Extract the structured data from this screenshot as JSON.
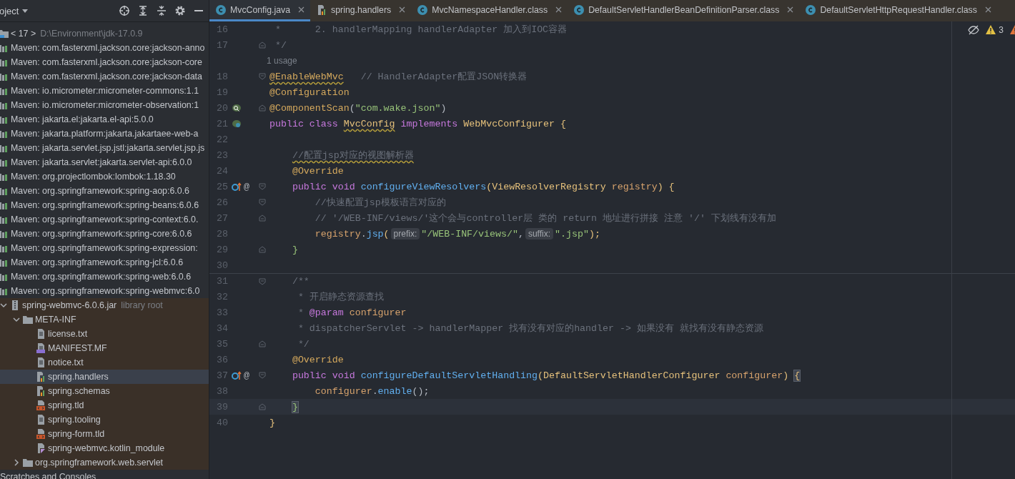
{
  "project_panel": {
    "title": "oject",
    "tree": [
      {
        "kind": "jdk",
        "label": "< 17 >",
        "detail": "D:\\Environment\\jdk-17.0.9",
        "selected": false
      },
      {
        "kind": "maven",
        "label": "Maven: com.fasterxml.jackson.core:jackson-anno",
        "selected": false
      },
      {
        "kind": "maven",
        "label": "Maven: com.fasterxml.jackson.core:jackson-core",
        "selected": false
      },
      {
        "kind": "maven",
        "label": "Maven: com.fasterxml.jackson.core:jackson-data",
        "selected": false
      },
      {
        "kind": "maven",
        "label": "Maven: io.micrometer:micrometer-commons:1.1",
        "selected": false
      },
      {
        "kind": "maven",
        "label": "Maven: io.micrometer:micrometer-observation:1",
        "selected": false
      },
      {
        "kind": "maven",
        "label": "Maven: jakarta.el:jakarta.el-api:5.0.0",
        "selected": false
      },
      {
        "kind": "maven",
        "label": "Maven: jakarta.platform:jakarta.jakartaee-web-a",
        "selected": false
      },
      {
        "kind": "maven",
        "label": "Maven: jakarta.servlet.jsp.jstl:jakarta.servlet.jsp.js",
        "selected": false
      },
      {
        "kind": "maven",
        "label": "Maven: jakarta.servlet:jakarta.servlet-api:6.0.0",
        "selected": false
      },
      {
        "kind": "maven",
        "label": "Maven: org.projectlombok:lombok:1.18.30",
        "selected": false
      },
      {
        "kind": "maven",
        "label": "Maven: org.springframework:spring-aop:6.0.6",
        "selected": false
      },
      {
        "kind": "maven",
        "label": "Maven: org.springframework:spring-beans:6.0.6",
        "selected": false
      },
      {
        "kind": "maven",
        "label": "Maven: org.springframework:spring-context:6.0.",
        "selected": false
      },
      {
        "kind": "maven",
        "label": "Maven: org.springframework:spring-core:6.0.6",
        "selected": false
      },
      {
        "kind": "maven",
        "label": "Maven: org.springframework:spring-expression:",
        "selected": false
      },
      {
        "kind": "maven",
        "label": "Maven: org.springframework:spring-jcl:6.0.6",
        "selected": false
      },
      {
        "kind": "maven",
        "label": "Maven: org.springframework:spring-web:6.0.6",
        "selected": false
      },
      {
        "kind": "maven",
        "label": "Maven: org.springframework:spring-webmvc:6.0",
        "selected": false,
        "children": [
          {
            "kind": "jar",
            "label": "spring-webmvc-6.0.6.jar",
            "detail": "library root",
            "selected": false,
            "expanded": true,
            "children": [
              {
                "kind": "folder",
                "label": "META-INF",
                "selected": false,
                "expanded": true,
                "children": [
                  {
                    "kind": "file",
                    "label": "license.txt",
                    "selected": false
                  },
                  {
                    "kind": "manifest",
                    "label": "MANIFEST.MF",
                    "selected": false
                  },
                  {
                    "kind": "file",
                    "label": "notice.txt",
                    "selected": false
                  },
                  {
                    "kind": "spring",
                    "label": "spring.handlers",
                    "selected": true
                  },
                  {
                    "kind": "spring",
                    "label": "spring.schemas",
                    "selected": false
                  },
                  {
                    "kind": "tld",
                    "label": "spring.tld",
                    "selected": false
                  },
                  {
                    "kind": "file",
                    "label": "spring.tooling",
                    "selected": false
                  },
                  {
                    "kind": "tld",
                    "label": "spring-form.tld",
                    "selected": false
                  },
                  {
                    "kind": "kotlin",
                    "label": "spring-webmvc.kotlin_module",
                    "selected": false
                  }
                ]
              },
              {
                "kind": "folder",
                "label": "org.springframework.web.servlet",
                "selected": false,
                "expanded": false
              }
            ]
          }
        ]
      },
      {
        "kind": "scratches",
        "label": "Scratches and Consoles",
        "selected": false
      }
    ]
  },
  "tabs": [
    {
      "kind": "class",
      "label": "MvcConfig.java",
      "selected": true
    },
    {
      "kind": "spring",
      "label": "spring.handlers",
      "selected": false
    },
    {
      "kind": "class",
      "label": "MvcNamespaceHandler.class",
      "selected": false
    },
    {
      "kind": "class",
      "label": "DefaultServletHandlerBeanDefinitionParser.class",
      "selected": false
    },
    {
      "kind": "class",
      "label": "DefaultServletHttpRequestHandler.class",
      "selected": false
    }
  ],
  "inspections": [
    {
      "kind": "warning",
      "count": "3"
    },
    {
      "kind": "error"
    }
  ],
  "code_lines": [
    {
      "number": "16",
      "tokens": [
        {
          "kind": "comment",
          "text": " *      2. handlerMapping handlerAdapter 加入到IOC容器"
        }
      ]
    },
    {
      "number": "17",
      "fold": {
        "kind": "end"
      },
      "tokens": [
        {
          "kind": "comment",
          "text": " */"
        }
      ]
    },
    {
      "kind": "usage",
      "text": "1 usage"
    },
    {
      "number": "18",
      "fold": {
        "kind": "start"
      },
      "tokens": [
        {
          "kind": "annotation",
          "text": "@EnableWebMvc",
          "warning": true
        },
        {
          "kind": "comment",
          "text": "   // HandlerAdapter配置JSON转换器"
        }
      ]
    },
    {
      "number": "19",
      "tokens": [
        {
          "kind": "annotation",
          "text": "@Configuration"
        }
      ]
    },
    {
      "number": "20",
      "fold": {
        "kind": "end"
      },
      "gutter": {
        "kind": "bean-scan"
      },
      "tokens": [
        {
          "kind": "annotation",
          "text": "@ComponentScan"
        },
        {
          "kind": "plain",
          "text": "("
        },
        {
          "kind": "string",
          "text": "\"com.wake.json\""
        },
        {
          "kind": "plain",
          "text": ")"
        }
      ]
    },
    {
      "number": "21",
      "gutter": {
        "kind": "bean"
      },
      "tokens": [
        {
          "kind": "keyword",
          "text": "public class "
        },
        {
          "kind": "type",
          "text": "MvcConfig",
          "warning": true
        },
        {
          "kind": "keyword",
          "text": " implements "
        },
        {
          "kind": "type",
          "text": "WebMvcConfigurer"
        },
        {
          "kind": "brace",
          "text": " {"
        }
      ]
    },
    {
      "number": "22"
    },
    {
      "number": "23",
      "tokens": [
        {
          "kind": "comment",
          "text": "    //配置jsp对应的视图解析器",
          "warning": true
        }
      ]
    },
    {
      "number": "24",
      "tokens": [
        {
          "kind": "annotation",
          "text": "    @Override"
        }
      ]
    },
    {
      "number": "25",
      "fold": {
        "kind": "start"
      },
      "gutter": {
        "kind": "override",
        "text": "@"
      },
      "tokens": [
        {
          "kind": "keyword",
          "text": "    public void "
        },
        {
          "kind": "method",
          "text": "configureViewResolvers"
        },
        {
          "kind": "brace",
          "text": "("
        },
        {
          "kind": "type",
          "text": "ViewResolverRegistry"
        },
        {
          "kind": "param",
          "text": " registry"
        },
        {
          "kind": "brace",
          "text": ") {"
        }
      ]
    },
    {
      "number": "26",
      "fold": {
        "kind": "start"
      },
      "tokens": [
        {
          "kind": "comment",
          "text": "        //快速配置jsp模板语言对应的"
        }
      ]
    },
    {
      "number": "27",
      "fold": {
        "kind": "end"
      },
      "tokens": [
        {
          "kind": "comment",
          "text": "        // '/WEB-INF/views/'这个会与controller层 类的 return 地址进行拼接 注意 '/' 下划线有没有加"
        }
      ]
    },
    {
      "number": "28",
      "tokens": [
        {
          "kind": "param",
          "text": "        registry"
        },
        {
          "kind": "plain",
          "text": "."
        },
        {
          "kind": "method",
          "text": "jsp"
        },
        {
          "kind": "brace",
          "text": "("
        },
        {
          "kind": "hint",
          "text": "prefix:"
        },
        {
          "kind": "string",
          "text": "\"/WEB-INF/views/\""
        },
        {
          "kind": "plain",
          "text": ","
        },
        {
          "kind": "hint",
          "text": "suffix:"
        },
        {
          "kind": "string",
          "text": "\".jsp\""
        },
        {
          "kind": "brace",
          "text": ");"
        }
      ]
    },
    {
      "number": "29",
      "fold": {
        "kind": "end"
      },
      "tokens": [
        {
          "kind": "block",
          "text": "    }"
        }
      ]
    },
    {
      "number": "30"
    },
    {
      "number": "31",
      "fold": {
        "kind": "start"
      },
      "separator": true,
      "tokens": [
        {
          "kind": "comment",
          "text": "    /**"
        }
      ]
    },
    {
      "number": "32",
      "tokens": [
        {
          "kind": "comment",
          "text": "     * 开启静态资源查找"
        }
      ]
    },
    {
      "number": "33",
      "tokens": [
        {
          "kind": "comment",
          "text": "     * "
        },
        {
          "kind": "doctag",
          "text": "@param"
        },
        {
          "kind": "param",
          "text": " configurer"
        }
      ]
    },
    {
      "number": "34",
      "tokens": [
        {
          "kind": "comment",
          "text": "     * dispatcherServlet -> handlerMapper 找有没有对应的handler -> 如果没有 就找有没有静态资源"
        }
      ]
    },
    {
      "number": "35",
      "fold": {
        "kind": "end"
      },
      "tokens": [
        {
          "kind": "comment",
          "text": "     */"
        }
      ]
    },
    {
      "number": "36",
      "tokens": [
        {
          "kind": "annotation",
          "text": "    @Override"
        }
      ]
    },
    {
      "number": "37",
      "fold": {
        "kind": "start"
      },
      "gutter": {
        "kind": "override",
        "text": "@"
      },
      "tokens": [
        {
          "kind": "keyword",
          "text": "    public void "
        },
        {
          "kind": "method",
          "text": "configureDefaultServletHandling"
        },
        {
          "kind": "brace",
          "text": "("
        },
        {
          "kind": "type",
          "text": "DefaultServletHandlerConfigurer"
        },
        {
          "kind": "param",
          "text": " configurer"
        },
        {
          "kind": "brace",
          "text": ") "
        },
        {
          "kind": "brace",
          "text": "{",
          "match": true
        }
      ]
    },
    {
      "number": "38",
      "tokens": [
        {
          "kind": "param",
          "text": "        configurer"
        },
        {
          "kind": "plain",
          "text": "."
        },
        {
          "kind": "method",
          "text": "enable"
        },
        {
          "kind": "plain",
          "text": "();"
        }
      ]
    },
    {
      "number": "39",
      "fold": {
        "kind": "end"
      },
      "current": true,
      "tokens": [
        {
          "kind": "block",
          "text": "    }",
          "match": true
        }
      ]
    },
    {
      "number": "40",
      "tokens": [
        {
          "kind": "brace",
          "text": "}"
        }
      ]
    }
  ]
}
